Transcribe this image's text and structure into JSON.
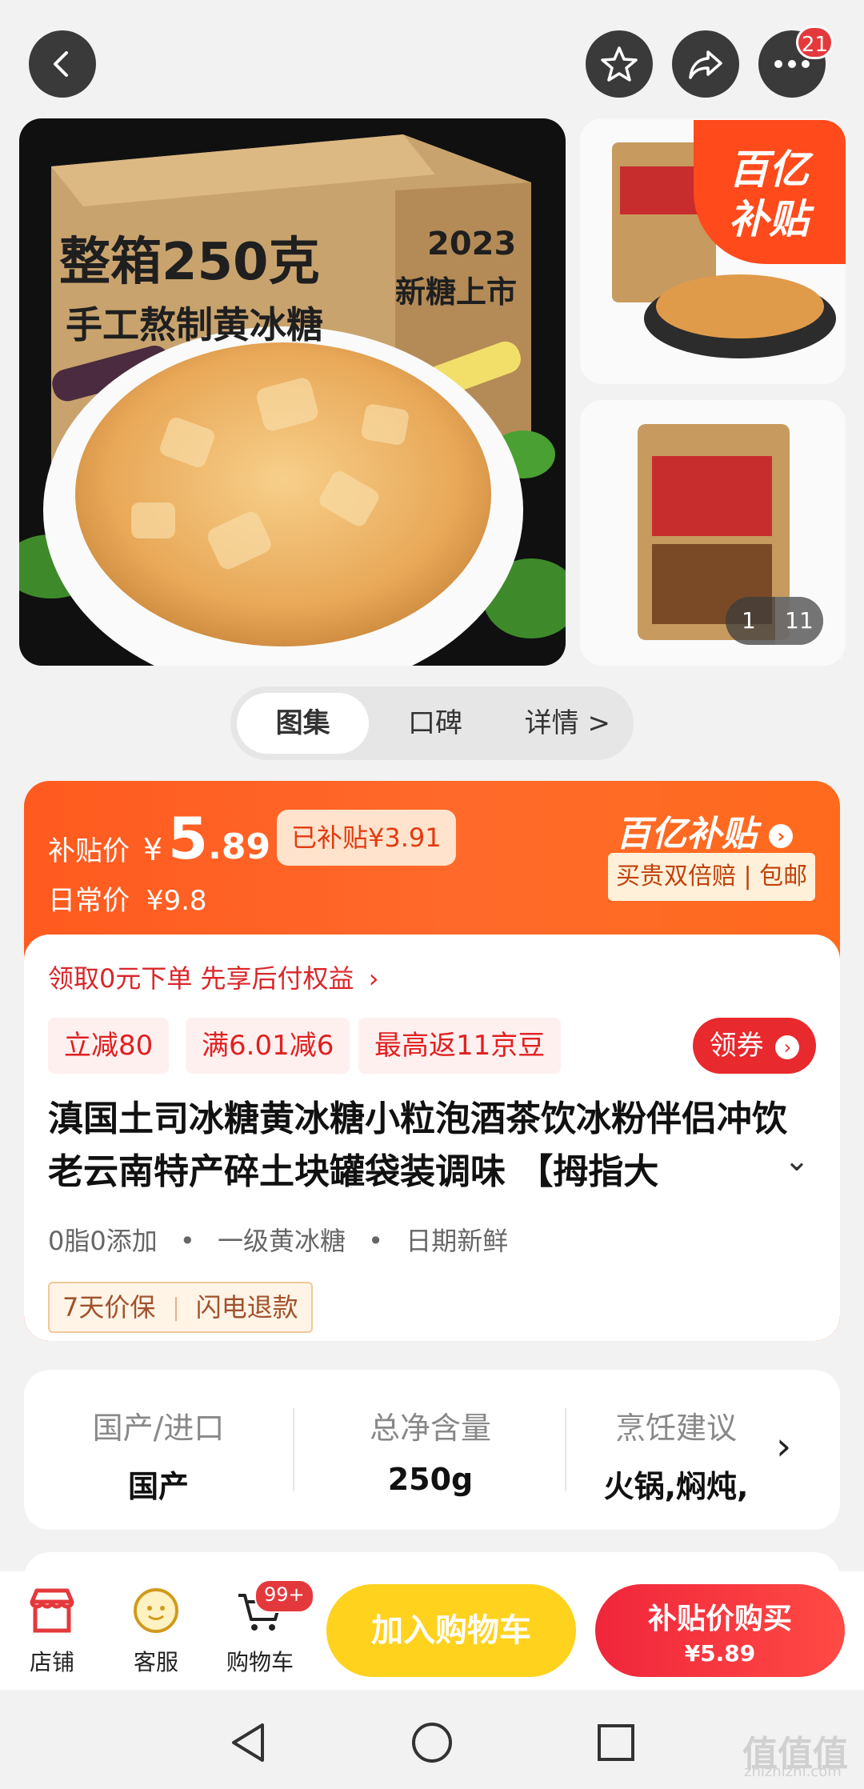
{
  "header": {
    "cart_badge": "21"
  },
  "gallery": {
    "hero_line1": "整箱250克",
    "hero_line2": "手工熬制黄冰糖",
    "hero_box_year": "2023",
    "hero_box_text": "新糖上市",
    "subsidy_badge_line1": "百亿",
    "subsidy_badge_line2": "补贴",
    "counter_current": "1",
    "counter_total": "11"
  },
  "tabs": [
    {
      "label": "图集"
    },
    {
      "label": "口碑"
    },
    {
      "label": "详情 >"
    }
  ],
  "price": {
    "subsidy_label": "补贴价",
    "currency": "¥",
    "int": "5",
    "dec": ".89",
    "subsidized_tag": "已补贴¥3.91",
    "daily_label": "日常价",
    "daily_price": "¥9.8",
    "program_title": "百亿补贴",
    "program_sub": "买贵双倍赔 | 包邮"
  },
  "credit_line": "领取0元下单 先享后付权益",
  "promos": [
    "立减80",
    "满6.01减6",
    "最高返11京豆"
  ],
  "coupon_button": "领券",
  "product_title": "滇国土司冰糖黄冰糖小粒泡酒茶饮冰粉伴侣冲饮老云南特产碎土块罐袋装调味 【拇指大",
  "features": [
    "0脂0添加",
    "一级黄冰糖",
    "日期新鲜"
  ],
  "services": [
    "7天价保",
    "闪电退款"
  ],
  "attributes": [
    {
      "label": "国产/进口",
      "value": "国产"
    },
    {
      "label": "总净含量",
      "value": "250g"
    },
    {
      "label": "烹饪建议",
      "value": "火锅,焖炖,"
    }
  ],
  "bottom_bar": {
    "store": "店铺",
    "service": "客服",
    "cart": "购物车",
    "cart_badge": "99+",
    "add_to_cart": "加入购物车",
    "buy_title": "补贴价购买",
    "buy_price": "¥5.89"
  },
  "watermark": {
    "main": "值值值",
    "domain": "zhizhizhi.com"
  },
  "colors": {
    "accent": "#ff5a1f",
    "red": "#e4393c",
    "yellow": "#ffd21e"
  }
}
